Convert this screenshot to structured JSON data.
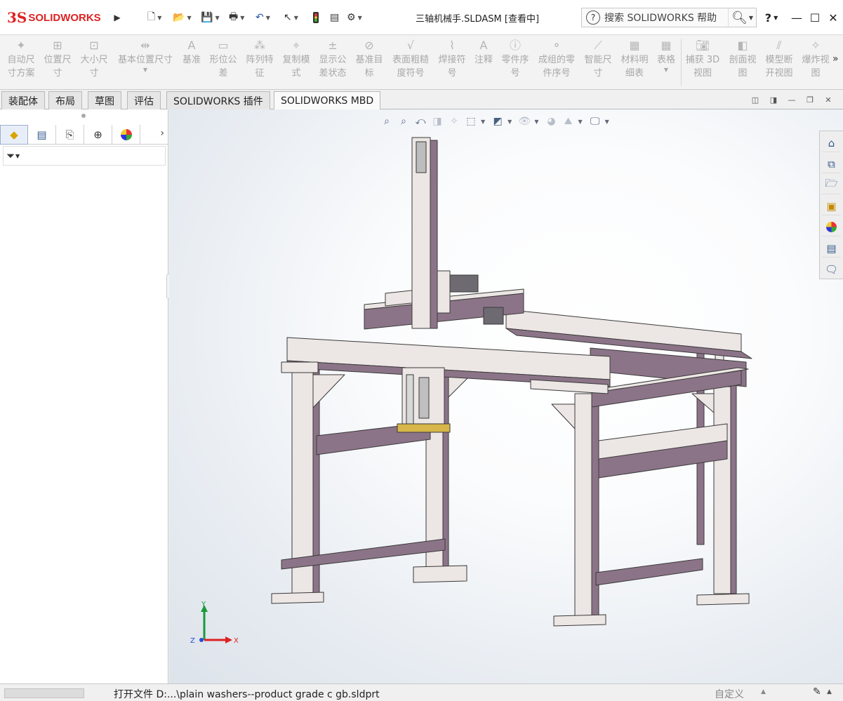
{
  "app": {
    "logo_ds": "3S",
    "logo_text": "SOLIDWORKS",
    "doc_title": "三轴机械手.SLDASM [查看中]",
    "search_placeholder": "搜索 SOLIDWORKS 帮助",
    "help_label": "?"
  },
  "ribbon": {
    "items": [
      {
        "label": "自动尺\n寸方案",
        "icon": "auto-dimension-icon"
      },
      {
        "label": "位置尺\n寸",
        "icon": "location-dimension-icon"
      },
      {
        "label": "大小尺\n寸",
        "icon": "size-dimension-icon"
      },
      {
        "label": "基本位置尺寸",
        "icon": "basic-location-dimension-icon"
      },
      {
        "label": "基准",
        "icon": "datum-icon"
      },
      {
        "label": "形位公\n差",
        "icon": "geometric-tolerance-icon"
      },
      {
        "label": "阵列特\n征",
        "icon": "pattern-feature-icon"
      },
      {
        "label": "复制模\n式",
        "icon": "copy-scheme-icon"
      },
      {
        "label": "显示公\n差状态",
        "icon": "show-tolerance-status-icon"
      },
      {
        "label": "基准目\n标",
        "icon": "datum-target-icon"
      },
      {
        "label": "表面粗糙\n度符号",
        "icon": "surface-finish-icon"
      },
      {
        "label": "焊接符\n号",
        "icon": "weld-symbol-icon"
      },
      {
        "label": "注释",
        "icon": "note-icon"
      },
      {
        "label": "零件序\n号",
        "icon": "balloon-icon"
      },
      {
        "label": "成组的零\n件序号",
        "icon": "stacked-balloon-icon"
      },
      {
        "label": "智能尺\n寸",
        "icon": "smart-dimension-icon"
      },
      {
        "label": "材料明\n细表",
        "icon": "bom-icon"
      },
      {
        "label": "表格",
        "icon": "table-icon"
      },
      {
        "label": "捕获 3D\n视图",
        "icon": "capture-3d-view-icon"
      },
      {
        "label": "剖面视\n图",
        "icon": "section-view-icon"
      },
      {
        "label": "模型断\n开视图",
        "icon": "model-break-view-icon"
      },
      {
        "label": "爆炸视\n图",
        "icon": "exploded-view-icon"
      }
    ],
    "more": "»"
  },
  "tabs": [
    {
      "label": "装配体"
    },
    {
      "label": "布局"
    },
    {
      "label": "草图"
    },
    {
      "label": "评估"
    },
    {
      "label": "SOLIDWORKS 插件"
    },
    {
      "label": "SOLIDWORKS MBD"
    }
  ],
  "status": {
    "message": "打开文件  D:...\\plain washers--product grade c gb.sldprt",
    "custom": "自定义"
  },
  "triad": {
    "x": "X",
    "y": "Y",
    "z": "Z"
  },
  "colors": {
    "brand": "#dd2222",
    "frame_purple": "#8c7488",
    "frame_light": "#ece6e4",
    "accent_blue": "#355a8c"
  }
}
